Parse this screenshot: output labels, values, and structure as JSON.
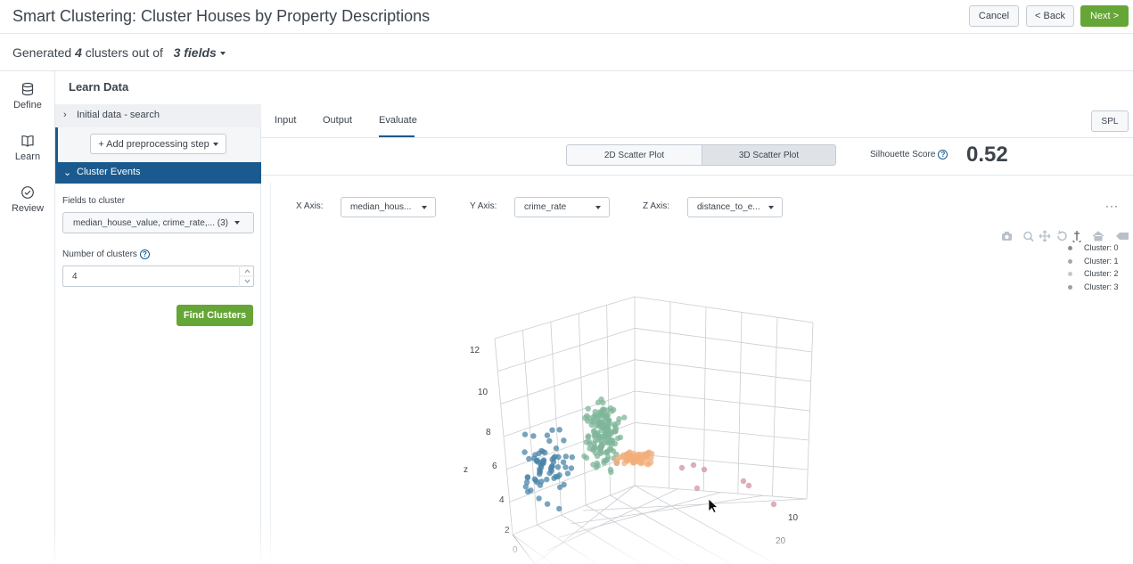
{
  "header": {
    "title": "Smart Clustering: Cluster Houses by Property Descriptions",
    "cancel_label": "Cancel",
    "back_label": "< Back",
    "next_label": "Next >"
  },
  "subheader": {
    "prefix": "Generated",
    "cluster_count": "4",
    "middle": "clusters out of",
    "fields_label": "3 fields"
  },
  "leftnav": {
    "items": [
      {
        "label": "Define",
        "icon": "database-icon"
      },
      {
        "label": "Learn",
        "icon": "book-icon"
      },
      {
        "label": "Review",
        "icon": "check-circle-icon"
      }
    ]
  },
  "learn": {
    "title": "Learn Data",
    "initial_data": "Initial data - search",
    "add_step": "+ Add preprocessing step",
    "cluster_events": "Cluster Events",
    "fields_label": "Fields to cluster",
    "fields_value": "median_house_value, crime_rate,...",
    "fields_count": "(3)",
    "num_clusters_label": "Number of clusters",
    "num_clusters_value": "4",
    "find_button": "Find Clusters"
  },
  "main": {
    "tabs": [
      {
        "label": "Input"
      },
      {
        "label": "Output"
      },
      {
        "label": "Evaluate",
        "active": true
      }
    ],
    "spl_label": "SPL",
    "toggle_2d": "2D Scatter Plot",
    "toggle_3d": "3D Scatter Plot",
    "selected_view": "3D Scatter Plot",
    "silhouette_label": "Silhouette Score",
    "silhouette_value": "0.52",
    "x_axis_label": "X Axis:",
    "x_axis_value": "median_hous...",
    "y_axis_label": "Y Axis:",
    "y_axis_value": "crime_rate",
    "z_axis_label": "Z Axis:",
    "z_axis_value": "distance_to_e...",
    "more": "···"
  },
  "colors": {
    "accent_blue": "#1a5a8e",
    "green": "#65a637",
    "cluster0": "#1f77b4",
    "cluster1": "#ff7f0e",
    "cluster2": "#2ca02c",
    "cluster3": "#d62728"
  },
  "chart_data": {
    "type": "scatter",
    "legend": [
      "Cluster: 0",
      "Cluster: 1",
      "Cluster: 2",
      "Cluster: 3"
    ],
    "z_label": "z",
    "z_ticks": [
      "0",
      "2",
      "4",
      "6",
      "8",
      "10",
      "12"
    ],
    "y_ticks": [
      "10",
      "20"
    ],
    "legend_position": "top-right"
  }
}
